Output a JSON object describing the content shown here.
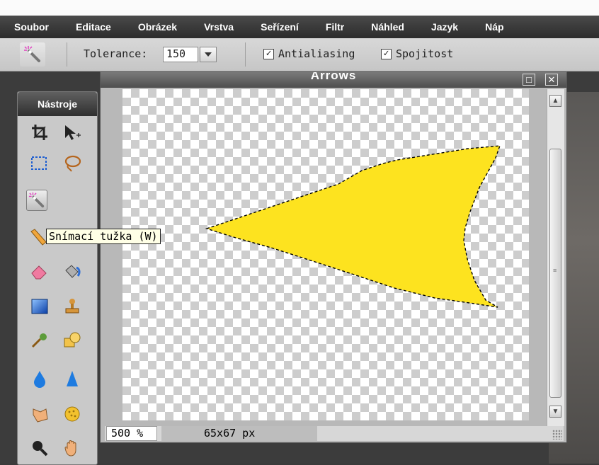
{
  "menu": [
    "Soubor",
    "Editace",
    "Obrázek",
    "Vrstva",
    "Seřízení",
    "Filtr",
    "Náhled",
    "Jazyk",
    "Náp"
  ],
  "options": {
    "tolerance_label": "Tolerance:",
    "tolerance_value": "150",
    "antialias_label": "Antialiasing",
    "antialias_checked": true,
    "contiguous_label": "Spojitost",
    "contiguous_checked": true
  },
  "toolpanel": {
    "title": "Nástroje",
    "tooltip": "Snímací tužka (W)",
    "active_tool": "magic-wand"
  },
  "document": {
    "title": "Arrows",
    "zoom": "500 %",
    "size": "65x67 px",
    "shape_color": "#fde31f"
  }
}
